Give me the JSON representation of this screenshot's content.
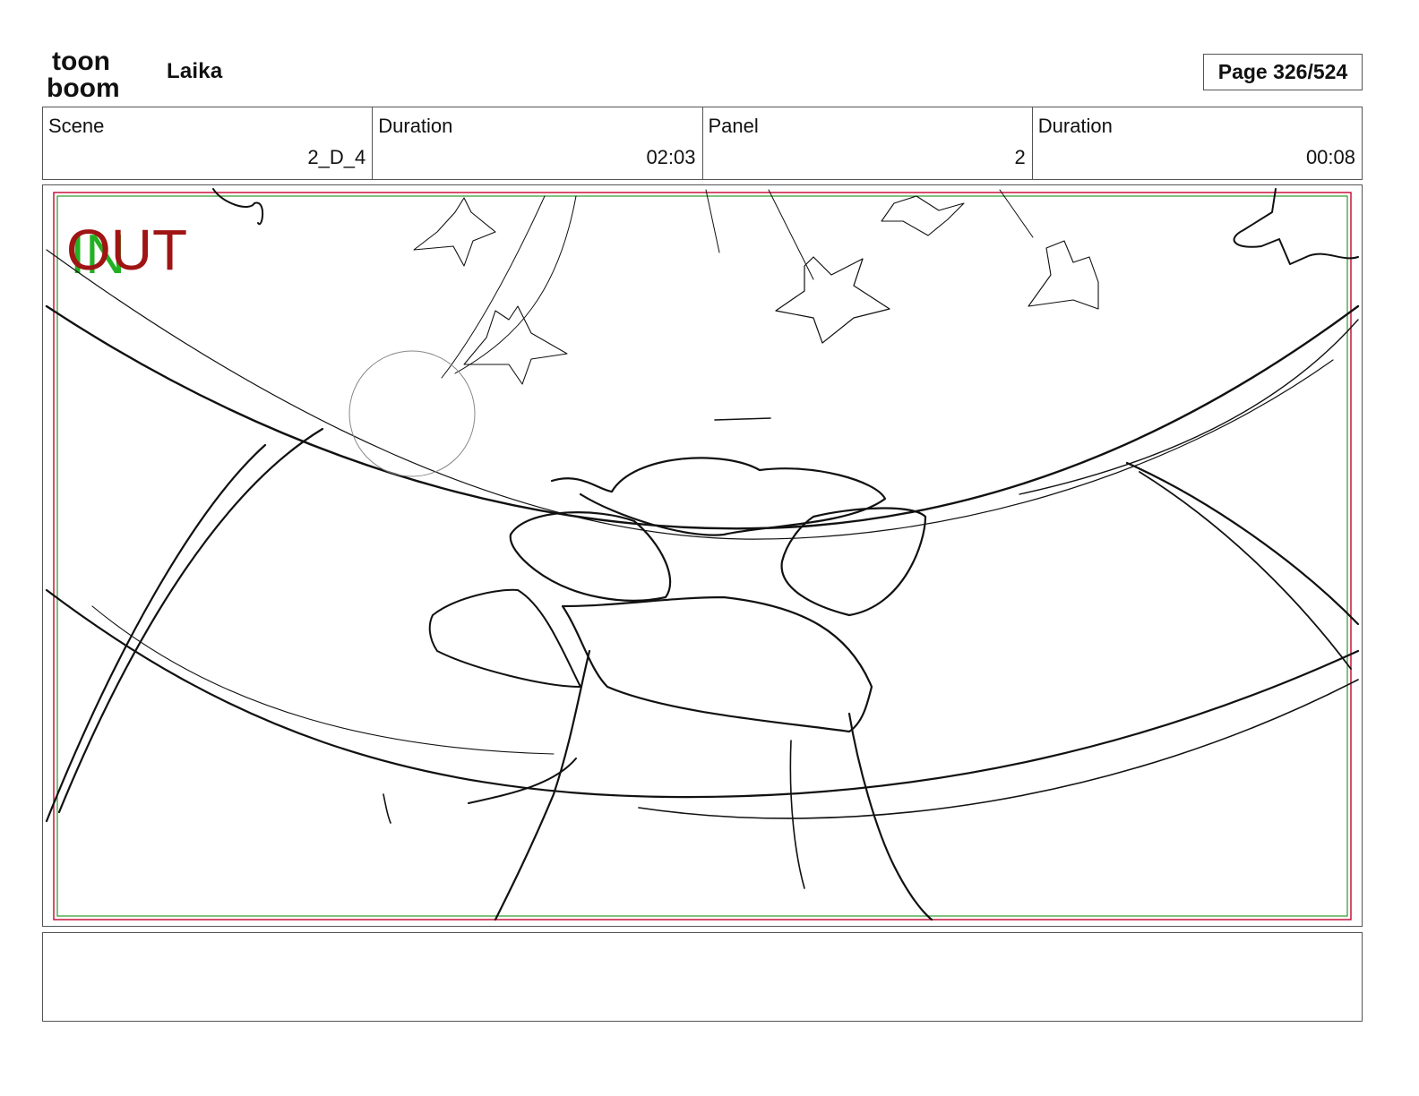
{
  "header": {
    "logo_text_top": "toon",
    "logo_text_bottom": "boom",
    "project_title": "Laika",
    "page_label": "Page 326/524"
  },
  "info": {
    "scene_label": "Scene",
    "scene_value": "2_D_4",
    "scene_duration_label": "Duration",
    "scene_duration_value": "02:03",
    "panel_label": "Panel",
    "panel_value": "2",
    "panel_duration_label": "Duration",
    "panel_duration_value": "00:08"
  },
  "panel": {
    "out_marker": "OUT",
    "in_marker": "IN",
    "out_color": "#a01414",
    "in_color": "#22b022",
    "safe_frame_red": "#c8143c",
    "safe_frame_green": "#2a9a2a"
  },
  "notes": {
    "text": ""
  }
}
